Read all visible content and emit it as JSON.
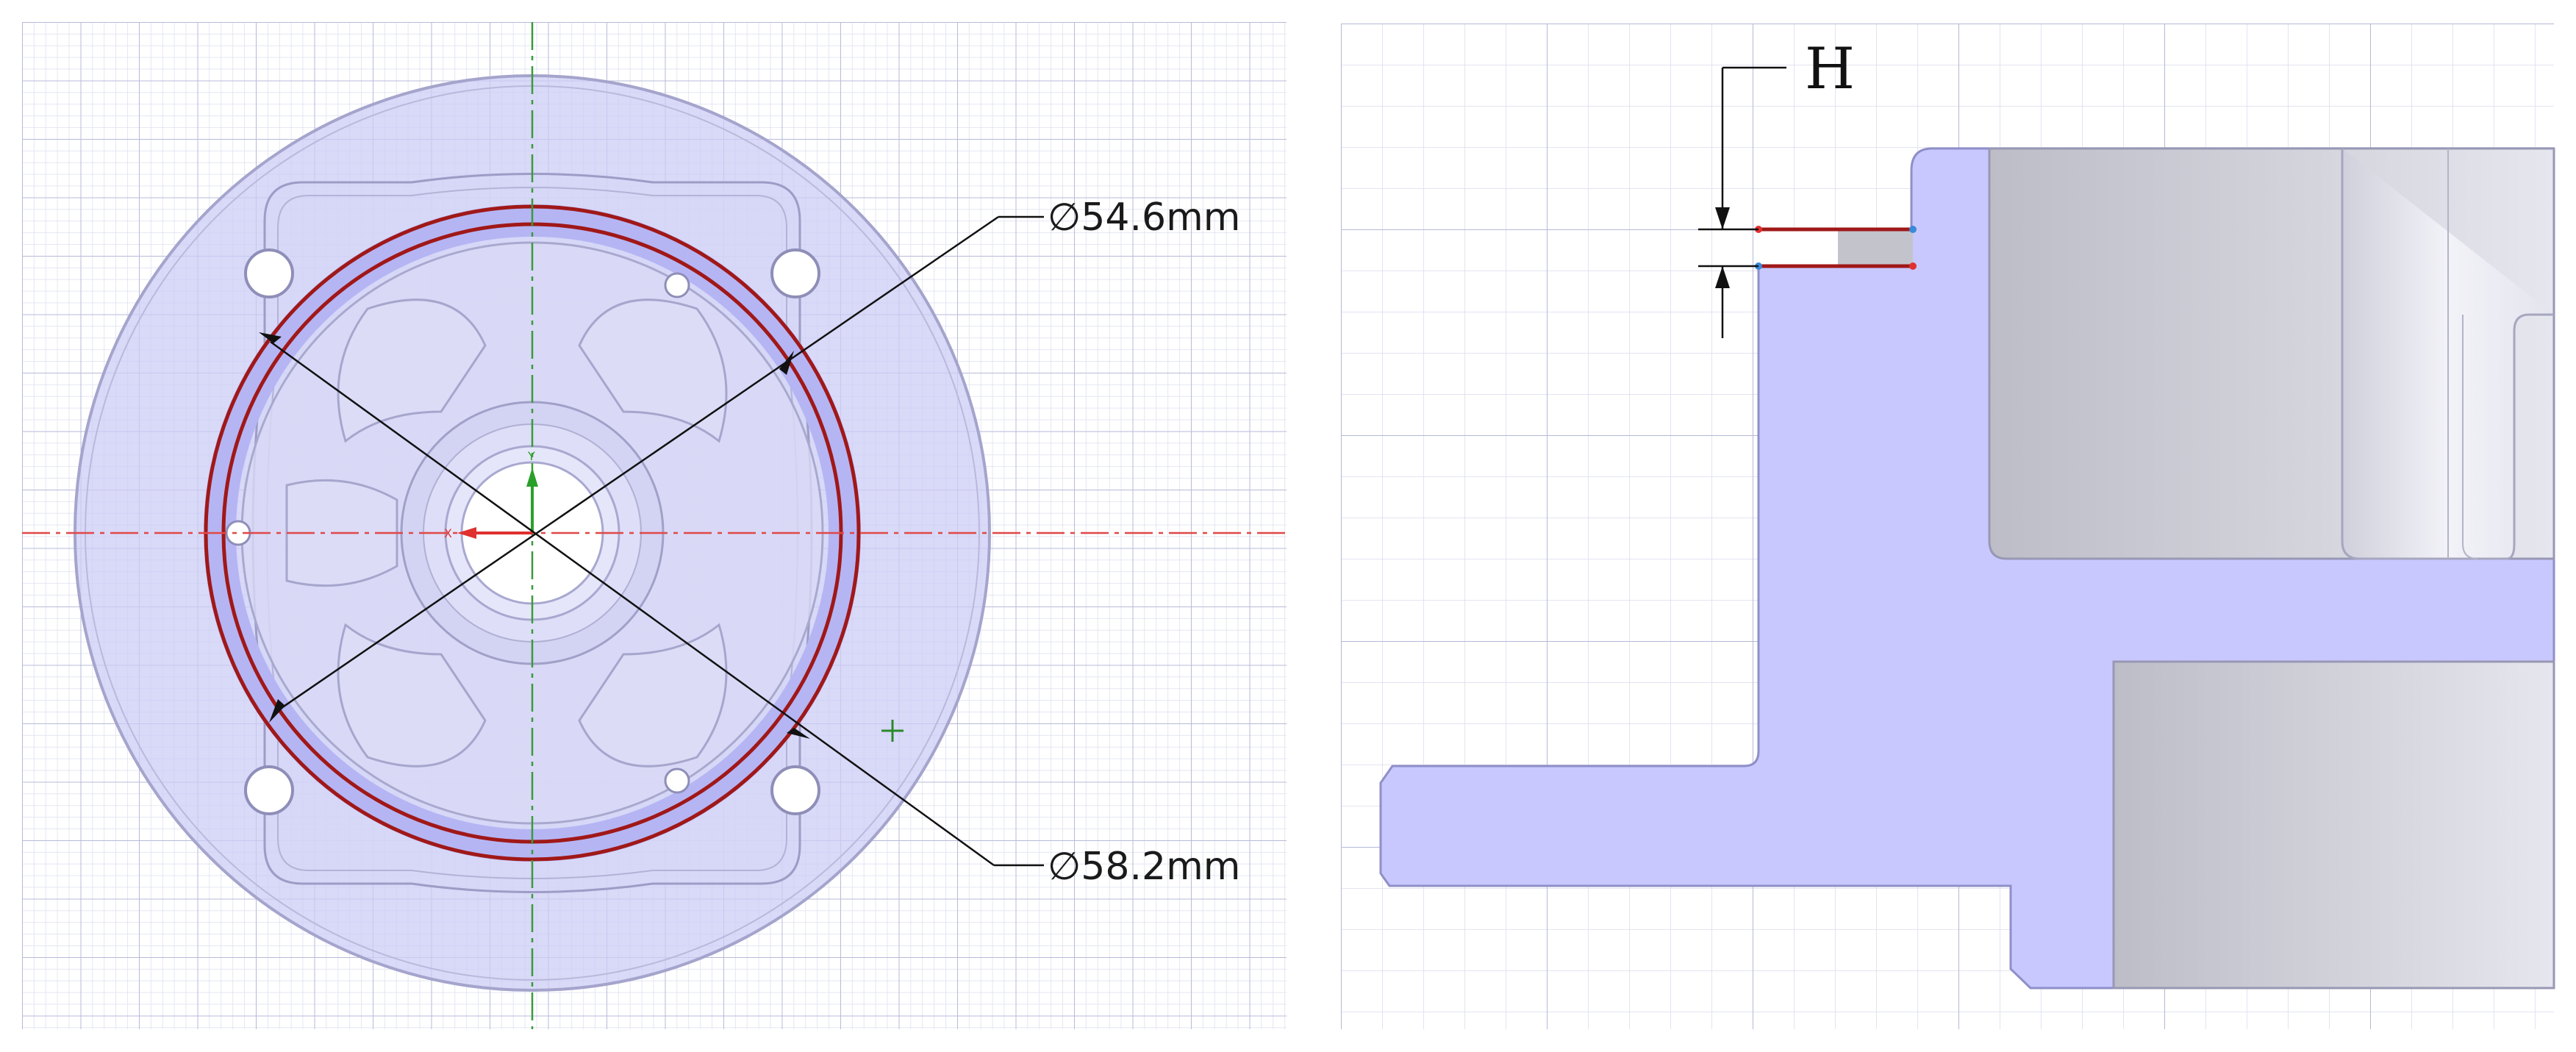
{
  "left_view": {
    "dim_outer": {
      "symbol": "∅",
      "value": "54.6mm"
    },
    "dim_inner": {
      "symbol": "∅",
      "value": "58.2mm"
    },
    "axis_x_label": "X",
    "axis_y_label": "Y"
  },
  "right_view": {
    "height_label": "H"
  },
  "colors": {
    "part_fill": "#c8c8ff",
    "part_edge": "#8f8fc8",
    "grid_major": "#9aa0c6",
    "grid_minor": "#d6d9ec",
    "highlight_red": "#a01818",
    "axis_green": "#2aa02a",
    "axis_red": "#e03030"
  }
}
